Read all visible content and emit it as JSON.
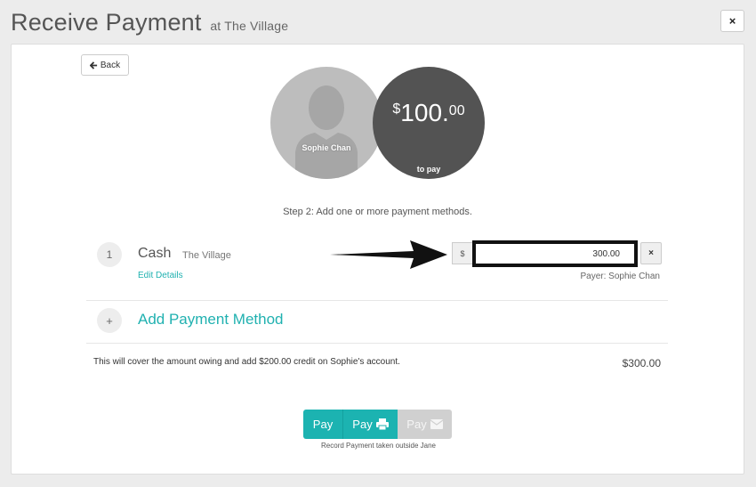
{
  "header": {
    "title": "Receive Payment",
    "location": "at The Village",
    "close_icon": "×"
  },
  "back_button": {
    "label": "Back",
    "icon": "arrow-left"
  },
  "patient": {
    "name": "Sophie Chan"
  },
  "amount_due": {
    "currency": "$",
    "whole": "100.",
    "cents": "00",
    "caption": "to pay"
  },
  "step_text": "Step 2: Add one or more payment methods.",
  "payment_methods": [
    {
      "index": "1",
      "method": "Cash",
      "location": "The Village",
      "edit_label": "Edit Details",
      "currency_addon": "$",
      "amount": "300.00",
      "payer": "Payer: Sophie Chan"
    }
  ],
  "add_method": {
    "icon": "+",
    "label": "Add Payment Method"
  },
  "summary": {
    "text": "This will cover the amount owing and add $200.00 credit on Sophie's account.",
    "total": "$300.00"
  },
  "pay_buttons": [
    {
      "label": "Pay",
      "icon": ""
    },
    {
      "label": "Pay",
      "icon": "print-icon"
    },
    {
      "label": "Pay",
      "icon": "envelope-icon",
      "disabled": true
    }
  ],
  "record_note": "Record Payment taken outside Jane",
  "colors": {
    "accent": "#1cb3b1",
    "dark_circle": "#535353",
    "disabled": "#d0d0d0"
  }
}
